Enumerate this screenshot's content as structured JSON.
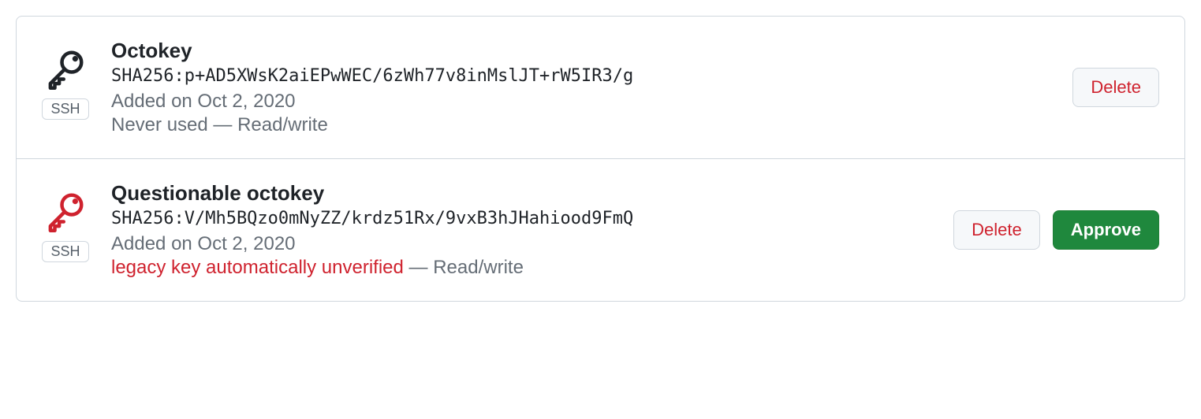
{
  "keys": [
    {
      "title": "Octokey",
      "fingerprint": "SHA256:p+AD5XWsK2aiEPwWEC/6zWh77v8inMslJT+rW5IR3/g",
      "added": "Added on Oct 2, 2020",
      "status_prefix": "Never used",
      "status_warning": "",
      "status_sep": " — ",
      "permission": "Read/write",
      "type_badge": "SSH",
      "icon_color": "#1f2328",
      "has_approve": false
    },
    {
      "title": "Questionable octokey",
      "fingerprint": "SHA256:V/Mh5BQzo0mNyZZ/krdz51Rx/9vxB3hJHahiood9FmQ",
      "added": "Added on Oct 2, 2020",
      "status_prefix": "",
      "status_warning": "legacy key automatically unverified",
      "status_sep": " — ",
      "permission": "Read/write",
      "type_badge": "SSH",
      "icon_color": "#cf222e",
      "has_approve": true
    }
  ],
  "buttons": {
    "delete": "Delete",
    "approve": "Approve"
  }
}
